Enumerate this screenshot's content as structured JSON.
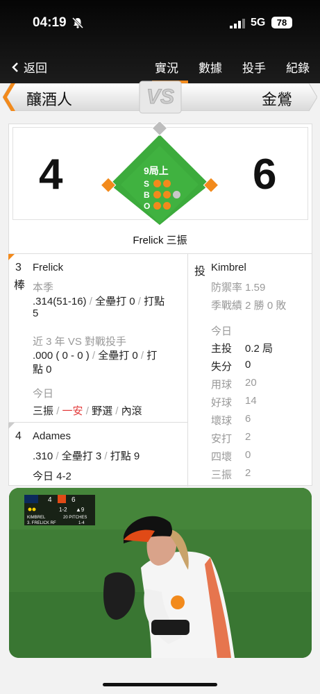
{
  "status": {
    "time": "04:19",
    "network": "5G",
    "battery": "78"
  },
  "nav": {
    "back_label": "返回",
    "tabs": [
      {
        "label": "實況",
        "active": true
      },
      {
        "label": "數據"
      },
      {
        "label": "投手"
      },
      {
        "label": "紀錄"
      }
    ]
  },
  "teams": {
    "away": "釀酒人",
    "home": "金鶯",
    "vs": "VS"
  },
  "score": {
    "away": "4",
    "home": "6",
    "inning": "9局上",
    "balls": 2,
    "strikes": 2,
    "outs": 2,
    "labels": {
      "s": "S",
      "b": "B",
      "o": "O"
    }
  },
  "last_play": "Frelick 三振",
  "batter": {
    "order": "3",
    "order_suffix": "棒",
    "name": "Frelick",
    "season_label": "本季",
    "season_avg": ".314(51-16)",
    "season_hr": "全壘打 0",
    "season_rbi_a": "打點",
    "season_rbi_b": "5",
    "vs_label": "近 3 年 VS 對戰投手",
    "vs_avg": ".000 ( 0 - 0 )",
    "vs_hr": "全壘打 0",
    "vs_rbi_a": "打",
    "vs_rbi_b": "點 0",
    "today_label": "今日",
    "today": [
      {
        "text": "三振",
        "highlight": false
      },
      {
        "text": "一安",
        "highlight": true
      },
      {
        "text": "野選",
        "highlight": false
      },
      {
        "text": "內滾",
        "highlight": false
      }
    ]
  },
  "next_batter": {
    "order": "4",
    "name": "Adames",
    "avg": ".310",
    "hr": "全壘打 3",
    "rbi": "打點 9",
    "today": "今日 4-2"
  },
  "pitcher": {
    "tag": "投",
    "name": "Kimbrel",
    "era": "防禦率 1.59",
    "record": "季戰績 2 勝 0 敗",
    "today_label": "今日",
    "stats": [
      {
        "label": "主投",
        "value": "0.2 局",
        "bold": true
      },
      {
        "label": "失分",
        "value": "0",
        "bold": true
      },
      {
        "label": "用球",
        "value": "20",
        "bold": false
      },
      {
        "label": "好球",
        "value": "14",
        "bold": false
      },
      {
        "label": "壞球",
        "value": "6",
        "bold": false
      },
      {
        "label": "安打",
        "value": "2",
        "bold": false
      },
      {
        "label": "四壞",
        "value": "0",
        "bold": false
      },
      {
        "label": "三振",
        "value": "2",
        "bold": false
      }
    ]
  },
  "broadcast": {
    "away_runs": "4",
    "home_runs": "6",
    "count": "1-2",
    "inning": "▲9",
    "pitcher": "KIMBREL",
    "pitches": "20 PITCHES",
    "batter": "3. FRELICK RF",
    "batter_line": "1-4"
  },
  "colors": {
    "accent": "#f28a1c",
    "field": "#3cab3c",
    "dot_on": "#f28a1c",
    "dot_off": "#c8c8c8"
  }
}
